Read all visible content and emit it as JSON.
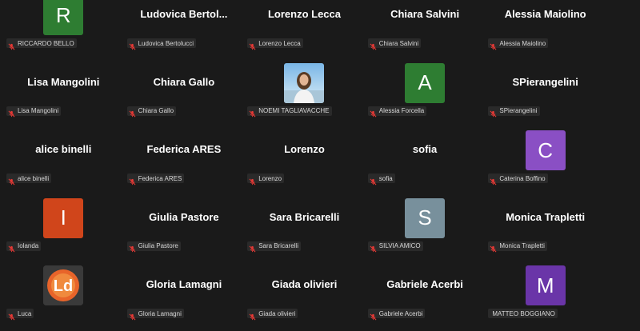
{
  "tiles": [
    {
      "display": "R",
      "type": "avatar",
      "color": "#2e7d32",
      "label": "RICCARDO BELLO"
    },
    {
      "display": "Ludovica  Bertol...",
      "type": "name",
      "label": "Ludovica Bertolucci"
    },
    {
      "display": "Lorenzo Lecca",
      "type": "name",
      "label": "Lorenzo Lecca"
    },
    {
      "display": "Chiara Salvini",
      "type": "name",
      "label": "Chiara Salvini"
    },
    {
      "display": "Alessia Maiolino",
      "type": "name",
      "label": "Alessia Maiolino"
    },
    {
      "display": "Lisa Mangolini",
      "type": "name",
      "label": "Lisa Mangolini"
    },
    {
      "display": "Chiara Gallo",
      "type": "name",
      "label": "Chiara Gallo"
    },
    {
      "display": "",
      "type": "photo",
      "label": "NOEMI TAGLIAVACCHE"
    },
    {
      "display": "A",
      "type": "avatar",
      "color": "#2e7d32",
      "label": "Alessia Forcella"
    },
    {
      "display": "SPierangelini",
      "type": "name",
      "label": "SPierangelini"
    },
    {
      "display": "alice binelli",
      "type": "name",
      "label": "alice binelli"
    },
    {
      "display": "Federica ARES",
      "type": "name",
      "label": "Federica ARES"
    },
    {
      "display": "Lorenzo",
      "type": "name",
      "label": "Lorenzo"
    },
    {
      "display": "sofia",
      "type": "name",
      "label": "sofia"
    },
    {
      "display": "C",
      "type": "avatar",
      "color": "#8a4fc4",
      "label": "Caterina Boffino"
    },
    {
      "display": "I",
      "type": "avatar",
      "color": "#d0451b",
      "label": "Iolanda"
    },
    {
      "display": "Giulia Pastore",
      "type": "name",
      "label": "Giulia Pastore"
    },
    {
      "display": "Sara Bricarelli",
      "type": "name",
      "label": "Sara Bricarelli"
    },
    {
      "display": "S",
      "type": "avatar",
      "color": "#78909c",
      "label": "SILVIA AMICO"
    },
    {
      "display": "Monica Trapletti",
      "type": "name",
      "label": "Monica Trapletti"
    },
    {
      "display": "Ld",
      "type": "logo",
      "label": "Luca"
    },
    {
      "display": "Gloria Lamagni",
      "type": "name",
      "label": "Gloria Lamagni"
    },
    {
      "display": "Giada olivieri",
      "type": "name",
      "label": "Giada olivieri"
    },
    {
      "display": "Gabriele Acerbi",
      "type": "name",
      "label": "Gabriele Acerbi"
    },
    {
      "display": "M",
      "type": "avatar",
      "color": "#6a35a8",
      "label": "MATTEO BOGGIANO",
      "muted": false
    }
  ],
  "icons": {
    "muted_mic": "muted-mic-icon"
  },
  "colors": {
    "muted": "#e53935",
    "background": "#1a1a1a",
    "name": "#ffffff"
  }
}
